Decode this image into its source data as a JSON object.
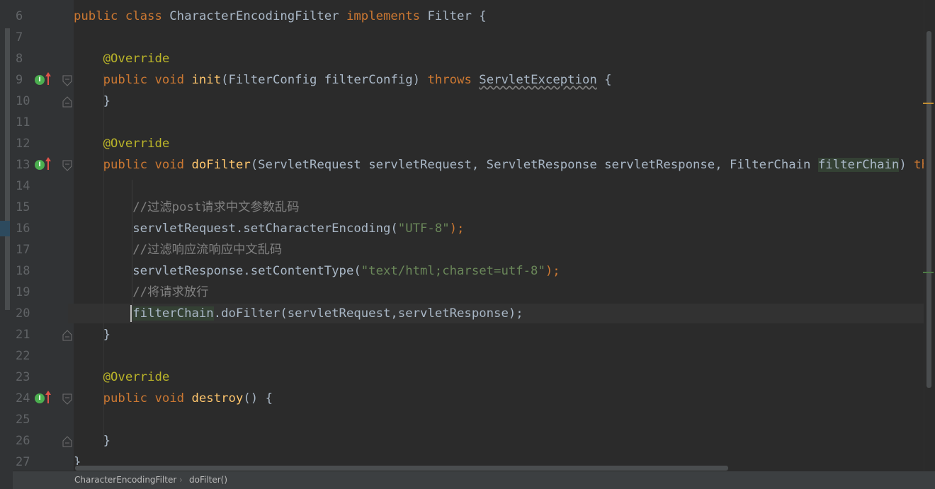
{
  "editor": {
    "line_numbers": [
      "6",
      "7",
      "8",
      "9",
      "10",
      "11",
      "12",
      "13",
      "14",
      "15",
      "16",
      "17",
      "18",
      "19",
      "20",
      "21",
      "22",
      "23",
      "24",
      "25",
      "26",
      "27"
    ],
    "tokens": {
      "kw_public": "public",
      "kw_class": "class",
      "kw_void": "void",
      "kw_implements": "implements",
      "kw_throws": "throws",
      "class_name": "CharacterEncodingFilter",
      "iface_filter": "Filter",
      "open_brace": "{",
      "close_brace": "}",
      "annotation": "@Override",
      "init_name": "init",
      "init_params": "(FilterConfig filterConfig) ",
      "servlet_exception": "ServletException",
      "dofilter_name": "doFilter",
      "dofilter_params": "(ServletRequest servletRequest, ServletResponse servletResponse, FilterChain ",
      "filter_chain_param": "filterChain",
      "close_paren": ") ",
      "comment_post": "//过滤post请求中文参数乱码",
      "req_call": "servletRequest.setCharacterEncoding(",
      "utf8_string": "\"UTF-8\"",
      "paren_semicolon": ");",
      "comment_response": "//过滤响应流响应中文乱码",
      "resp_call": "servletResponse.setContentType(",
      "content_type_string": "\"text/html;charset=utf-8\"",
      "comment_release": "//将请求放行",
      "filter_chain_usage": "filterChain",
      "chain_call": ".doFilter(servletRequest,servletResponse);",
      "destroy_name": "destroy",
      "destroy_params": "() "
    }
  },
  "breadcrumb": {
    "class_name": "CharacterEncodingFilter",
    "separator": "›",
    "method_name": "doFilter()"
  },
  "gutter_icons": {
    "implements_icon_glyph": "I"
  },
  "colors": {
    "background": "#2b2b2b",
    "keyword": "#cc7832",
    "annotation": "#bbb529",
    "method": "#ffc66d",
    "string": "#6a8759",
    "comment": "#808080",
    "text": "#a9b7c6"
  }
}
